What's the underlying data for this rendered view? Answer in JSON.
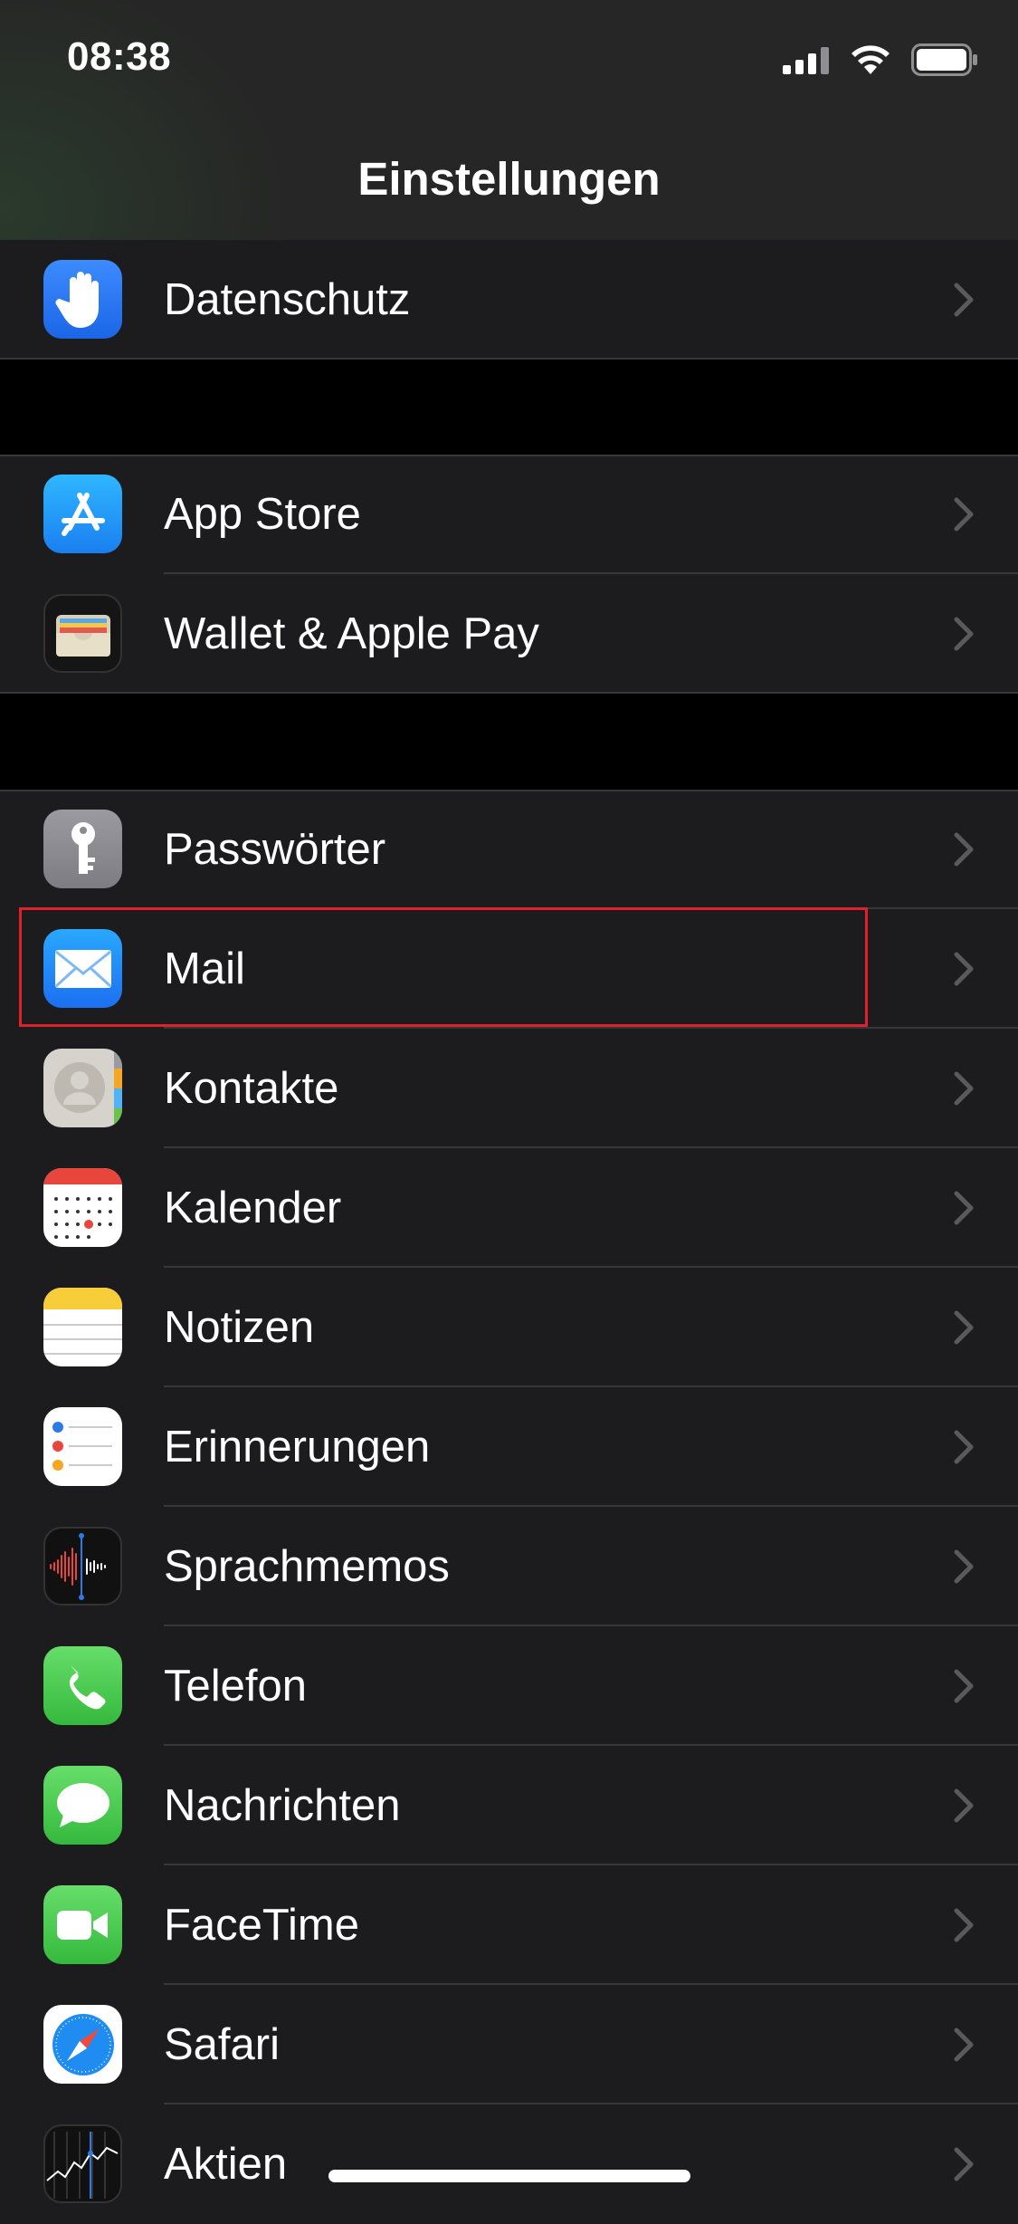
{
  "status_bar": {
    "time": "08:38"
  },
  "nav": {
    "title": "Einstellungen"
  },
  "groups": [
    {
      "items": [
        {
          "label": "Datenschutz",
          "icon": "hand-raised-icon"
        }
      ]
    },
    {
      "items": [
        {
          "label": "App Store",
          "icon": "app-store-icon"
        },
        {
          "label": "Wallet & Apple Pay",
          "icon": "wallet-icon"
        }
      ]
    },
    {
      "items": [
        {
          "label": "Passwörter",
          "icon": "key-icon"
        },
        {
          "label": "Mail",
          "icon": "envelope-icon",
          "highlighted": true
        },
        {
          "label": "Kontakte",
          "icon": "contacts-icon"
        },
        {
          "label": "Kalender",
          "icon": "calendar-icon"
        },
        {
          "label": "Notizen",
          "icon": "notes-icon"
        },
        {
          "label": "Erinnerungen",
          "icon": "reminders-icon"
        },
        {
          "label": "Sprachmemos",
          "icon": "voice-memos-icon"
        },
        {
          "label": "Telefon",
          "icon": "phone-icon"
        },
        {
          "label": "Nachrichten",
          "icon": "messages-icon"
        },
        {
          "label": "FaceTime",
          "icon": "facetime-icon"
        },
        {
          "label": "Safari",
          "icon": "safari-icon"
        },
        {
          "label": "Aktien",
          "icon": "stocks-icon"
        }
      ]
    }
  ],
  "colors": {
    "background": "#000000",
    "cell": "#1c1c1e",
    "highlight": "#e0202a"
  }
}
